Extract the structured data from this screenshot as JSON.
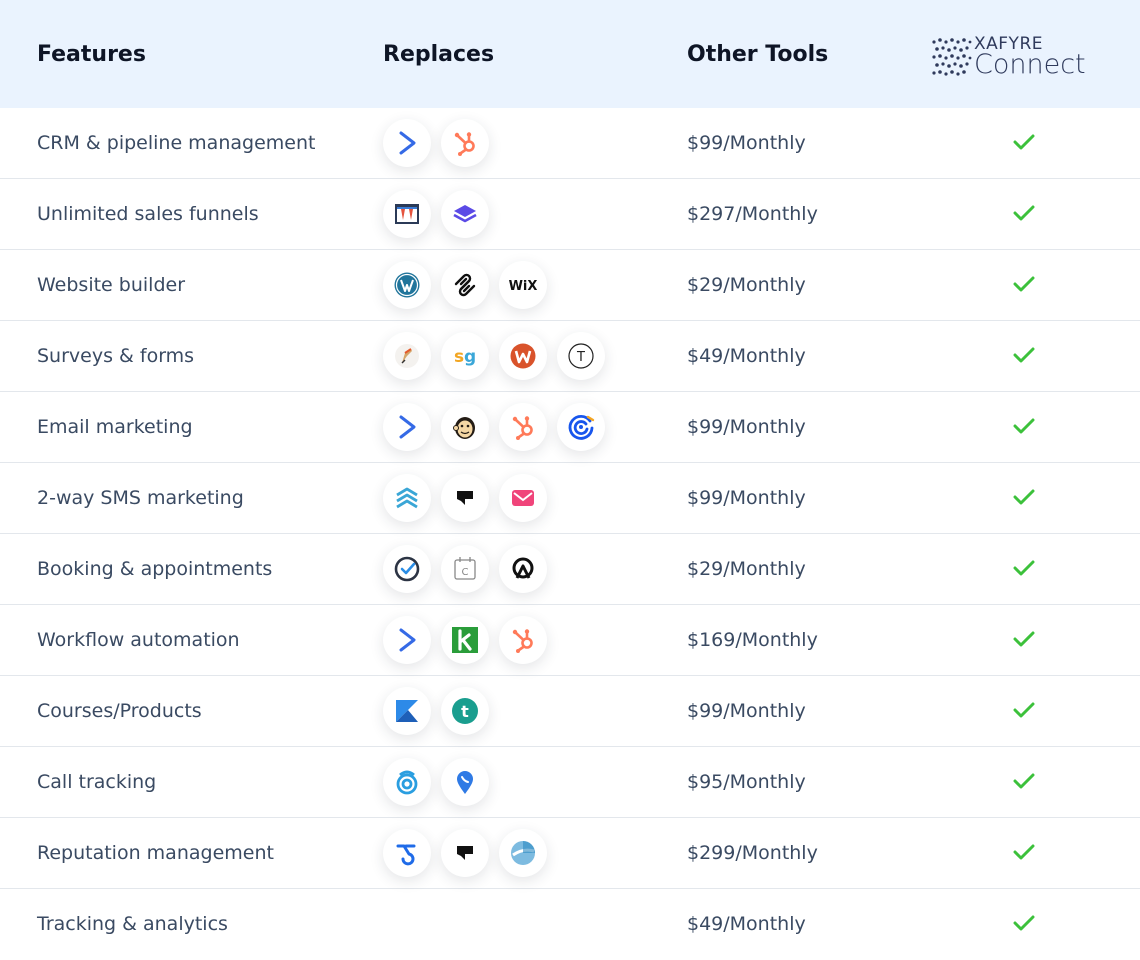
{
  "header": {
    "features": "Features",
    "replaces": "Replaces",
    "other_tools": "Other Tools",
    "logo_top": "XAFYRE",
    "logo_bottom": "Connect"
  },
  "colors": {
    "header_bg": "#eaf3fe",
    "check": "#3cc13b",
    "text": "#3a4a62"
  },
  "rows": [
    {
      "feature": "CRM & pipeline management",
      "price": "$99/Monthly",
      "icons": [
        "activecampaign-icon",
        "hubspot-icon"
      ]
    },
    {
      "feature": "Unlimited sales funnels",
      "price": "$297/Monthly",
      "icons": [
        "clickfunnels-icon",
        "layers-icon"
      ]
    },
    {
      "feature": "Website builder",
      "price": "$29/Monthly",
      "icons": [
        "wordpress-icon",
        "squarespace-icon",
        "wix-icon"
      ]
    },
    {
      "feature": "Surveys & forms",
      "price": "$49/Monthly",
      "icons": [
        "pen-icon",
        "surveygizmo-icon",
        "wufoo-icon",
        "typeform-icon"
      ]
    },
    {
      "feature": "Email marketing",
      "price": "$99/Monthly",
      "icons": [
        "activecampaign-icon",
        "mailchimp-icon",
        "hubspot-icon",
        "constantcontact-icon"
      ]
    },
    {
      "feature": "2-way SMS marketing",
      "price": "$99/Monthly",
      "icons": [
        "chevrons-up-icon",
        "podium-icon",
        "mail-icon"
      ]
    },
    {
      "feature": "Booking & appointments",
      "price": "$29/Monthly",
      "icons": [
        "check-circle-icon",
        "calendar-icon",
        "acuity-icon"
      ]
    },
    {
      "feature": "Workflow automation",
      "price": "$169/Monthly",
      "icons": [
        "activecampaign-icon",
        "keap-icon",
        "hubspot-icon"
      ]
    },
    {
      "feature": "Courses/Products",
      "price": "$99/Monthly",
      "icons": [
        "kajabi-icon",
        "teachable-icon"
      ]
    },
    {
      "feature": "Call tracking",
      "price": "$95/Monthly",
      "icons": [
        "callrail-icon",
        "pin-icon"
      ]
    },
    {
      "feature": "Reputation management",
      "price": "$299/Monthly",
      "icons": [
        "birdeye-icon",
        "podium-icon",
        "grade-icon"
      ]
    },
    {
      "feature": "Tracking & analytics",
      "price": "$49/Monthly",
      "icons": []
    }
  ]
}
